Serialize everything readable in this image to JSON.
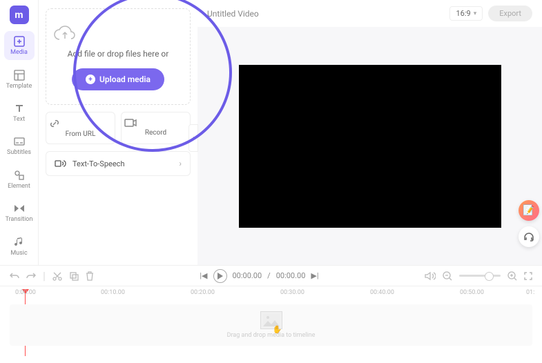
{
  "logo": "m",
  "sidebar": {
    "items": [
      {
        "label": "Media"
      },
      {
        "label": "Template"
      },
      {
        "label": "Text"
      },
      {
        "label": "Subtitles"
      },
      {
        "label": "Element"
      },
      {
        "label": "Transition"
      },
      {
        "label": "Music"
      }
    ]
  },
  "media": {
    "drop_text": "Add file or drop files here or",
    "upload_label": "Upload media",
    "from_url": "From URL",
    "record": "Record",
    "tts": "Text-To-Speech"
  },
  "header": {
    "title": "Untitled Video",
    "aspect": "16:9",
    "export": "Export"
  },
  "player": {
    "current": "00:00.00",
    "sep": "/",
    "duration": "00:00.00"
  },
  "timeline": {
    "ticks": [
      "0:00.00",
      "00:10.00",
      "00:20.00",
      "00:30.00",
      "00:40.00",
      "00:50.00",
      "01:"
    ],
    "hint": "Drag and drop media to timeline"
  }
}
